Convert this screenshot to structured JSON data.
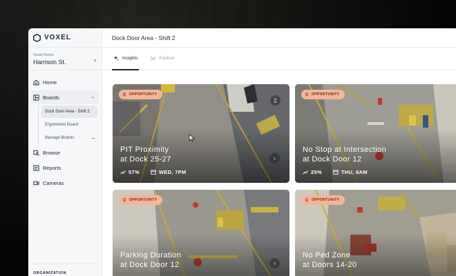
{
  "brand": {
    "name": "VOXEL"
  },
  "org": {
    "label": "Voxel Demo",
    "site": "Harrison St."
  },
  "nav": {
    "home": "Home",
    "boards": "Boards",
    "board_items": [
      "Dock Door Area - Shift 2",
      "Ergonomist Board",
      "Manage Boards"
    ],
    "browse": "Browse",
    "reports": "Reports",
    "cameras": "Cameras"
  },
  "footer": {
    "organization": "ORGANIZATION"
  },
  "header": {
    "title": "Dock Door Area - Shift 2"
  },
  "tabs": [
    {
      "label": "Insights",
      "icon": "sparkle-icon",
      "active": true
    },
    {
      "label": "Explore",
      "icon": "trend-icon",
      "active": false
    }
  ],
  "cards": [
    {
      "badge": "OPPORTUNITY",
      "title_line1": "PIT Proximity",
      "title_line2": "at Dock 25-27",
      "percent": "57%",
      "date": "WED, 7PM"
    },
    {
      "badge": "OPPORTUNITY",
      "title_line1": "No Stop at Intersection",
      "title_line2": "at Dock Door 12",
      "percent": "25%",
      "date": "THU, 8AM"
    },
    {
      "badge": "OPPORTUNITY",
      "title_line1": "Parking Duration",
      "title_line2": "at Dock Door 12",
      "percent": "",
      "date": ""
    },
    {
      "badge": "OPPORTUNITY",
      "title_line1": "No Ped Zone",
      "title_line2": "at Doors 14-20",
      "percent": "",
      "date": ""
    }
  ],
  "colors": {
    "badge_bg": "#f4b59a",
    "badge_text": "#6b2a12",
    "sidebar_bg": "#f6f7f8"
  }
}
